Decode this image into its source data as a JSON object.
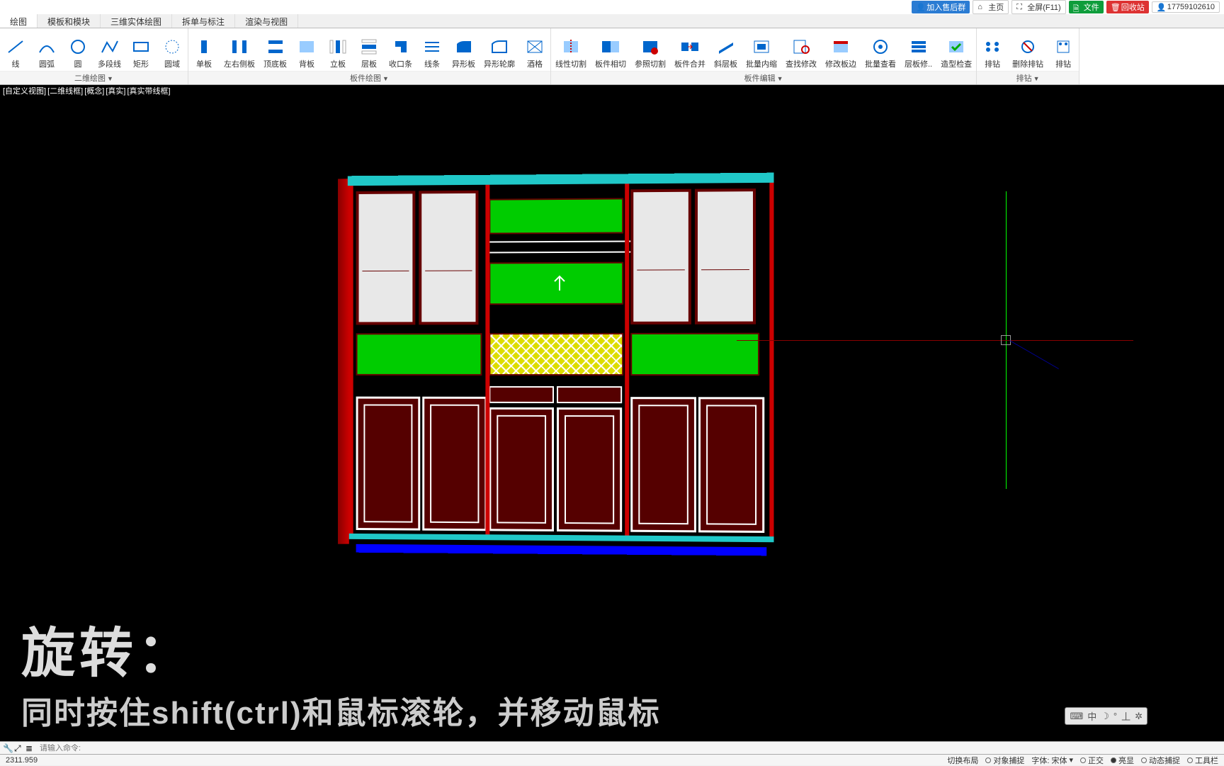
{
  "topbar": {
    "join_group": "加入售后群",
    "home": "主页",
    "fullscreen": "全屏(F11)",
    "file": "文件",
    "recycle": "回收站",
    "user": "17759102610"
  },
  "tabs": [
    "绘图",
    "模板和模块",
    "三维实体绘图",
    "拆单与标注",
    "渲染与视图"
  ],
  "ribbon": {
    "g1_title": "二维绘图",
    "g1": [
      "线",
      "圆弧",
      "圆",
      "多段线",
      "矩形",
      "圆域"
    ],
    "g2_title": "板件绘图",
    "g2": [
      "单板",
      "左右侧板",
      "顶底板",
      "背板",
      "立板",
      "层板",
      "收口条",
      "线条",
      "异形板",
      "异形轮廓",
      "酒格"
    ],
    "g3_title": "板件编辑",
    "g3": [
      "线性切割",
      "板件相切",
      "参照切割",
      "板件合并",
      "斜层板",
      "批量内缩",
      "查找修改",
      "修改板边",
      "批量查看",
      "层板修..",
      "造型检查"
    ],
    "g4_title": "排钻",
    "g4": [
      "排钻",
      "删除排钻",
      "排钻"
    ]
  },
  "viewtabs": [
    "[自定义视图]",
    "[二维线框]",
    "[概念]",
    "[真实]",
    "[真实带线框]"
  ],
  "overlay": {
    "line1": "旋转：",
    "line2": "同时按住shift(ctrl)和鼠标滚轮，并移动鼠标"
  },
  "ime": {
    "kb": "⌨",
    "zh": "中",
    "moon": "☽",
    "punct": "°",
    "sep": "丄",
    "gear": "✲"
  },
  "cmdline": {
    "placeholder": "请输入命令:"
  },
  "status": {
    "coord": "2311.959",
    "items": [
      "切换布局",
      "对象捕捉",
      "字体:",
      "正交",
      "亮显",
      "动态捕捉",
      "工具栏"
    ],
    "font": "宋体"
  }
}
